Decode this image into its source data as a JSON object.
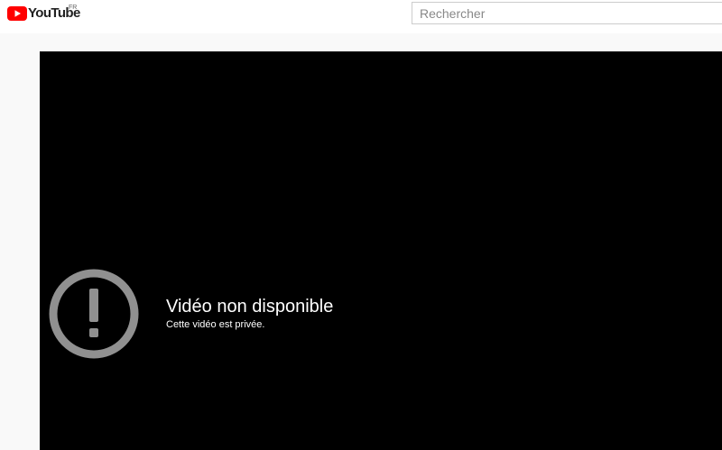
{
  "header": {
    "logo_text": "YouTube",
    "region": "FR",
    "search": {
      "placeholder": "Rechercher",
      "value": ""
    }
  },
  "player": {
    "error_icon": "exclamation-circle-icon",
    "error_title": "Vidéo non disponible",
    "error_subtitle": "Cette vidéo est privée."
  },
  "colors": {
    "brand_red": "#ff0000",
    "page_background": "#f9f9f9",
    "player_background": "#000000",
    "icon_gray": "#909090"
  }
}
